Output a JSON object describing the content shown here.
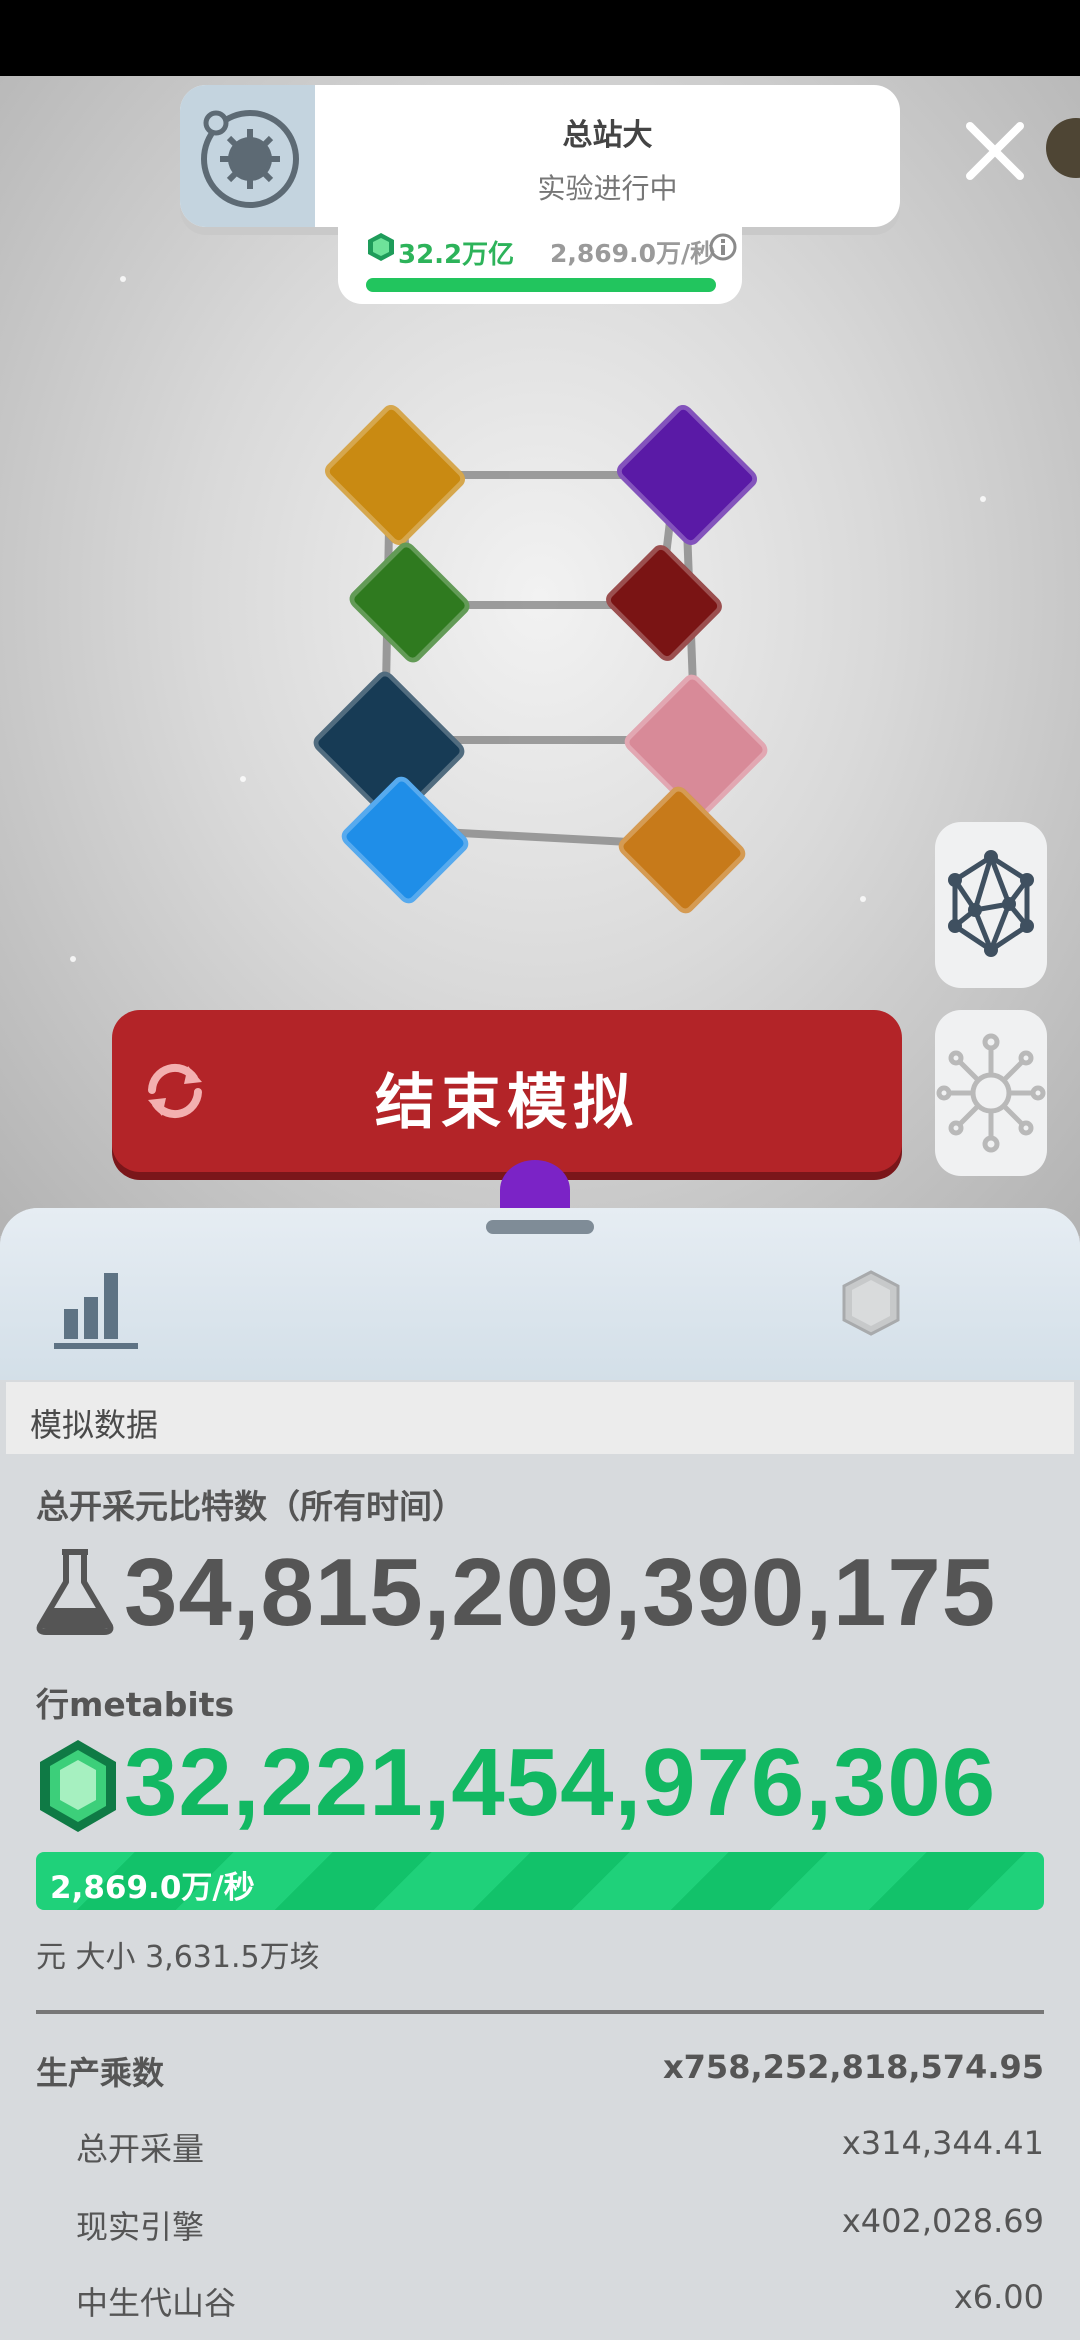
{
  "header": {
    "station_title": "总站大",
    "station_subtitle": "实验进行中",
    "resource_amount": "32.2万亿",
    "resource_rate": "2,869.0万/秒",
    "pill_progress": 1.0
  },
  "colors": {
    "accent_red": "#b32428",
    "metabit_green": "#12b862",
    "rate_bar_green": "#1fd17a"
  },
  "main": {
    "end_button_label": "结束模拟"
  },
  "panel": {
    "section_title": "模拟数据",
    "total_label": "总开采元比特数（所有时间）",
    "total_value": "34,815,209,390,175",
    "metabits_label": "行metabits",
    "metabits_value": "32,221,454,976,306",
    "rate_text": "2,869.0万/秒",
    "size_text": "元 大小 3,631.5万垓",
    "multipliers": [
      {
        "name": "生产乘数",
        "value": "x758,252,818,574.95",
        "main": true
      },
      {
        "name": "总开采量",
        "value": "x314,344.41",
        "main": false
      },
      {
        "name": "现实引擎",
        "value": "x402,028.69",
        "main": false
      },
      {
        "name": "中生代山谷",
        "value": "x6.00",
        "main": false
      }
    ]
  },
  "icons": {
    "station": "gear-planet-icon",
    "close": "close-icon",
    "info": "info-icon",
    "refresh": "refresh-icon",
    "network": "network-icon",
    "virus": "virus-icon",
    "chart": "bar-chart-icon",
    "prestige": "gem-icon",
    "flask": "flask-icon",
    "metabit": "metabit-gem-icon"
  }
}
